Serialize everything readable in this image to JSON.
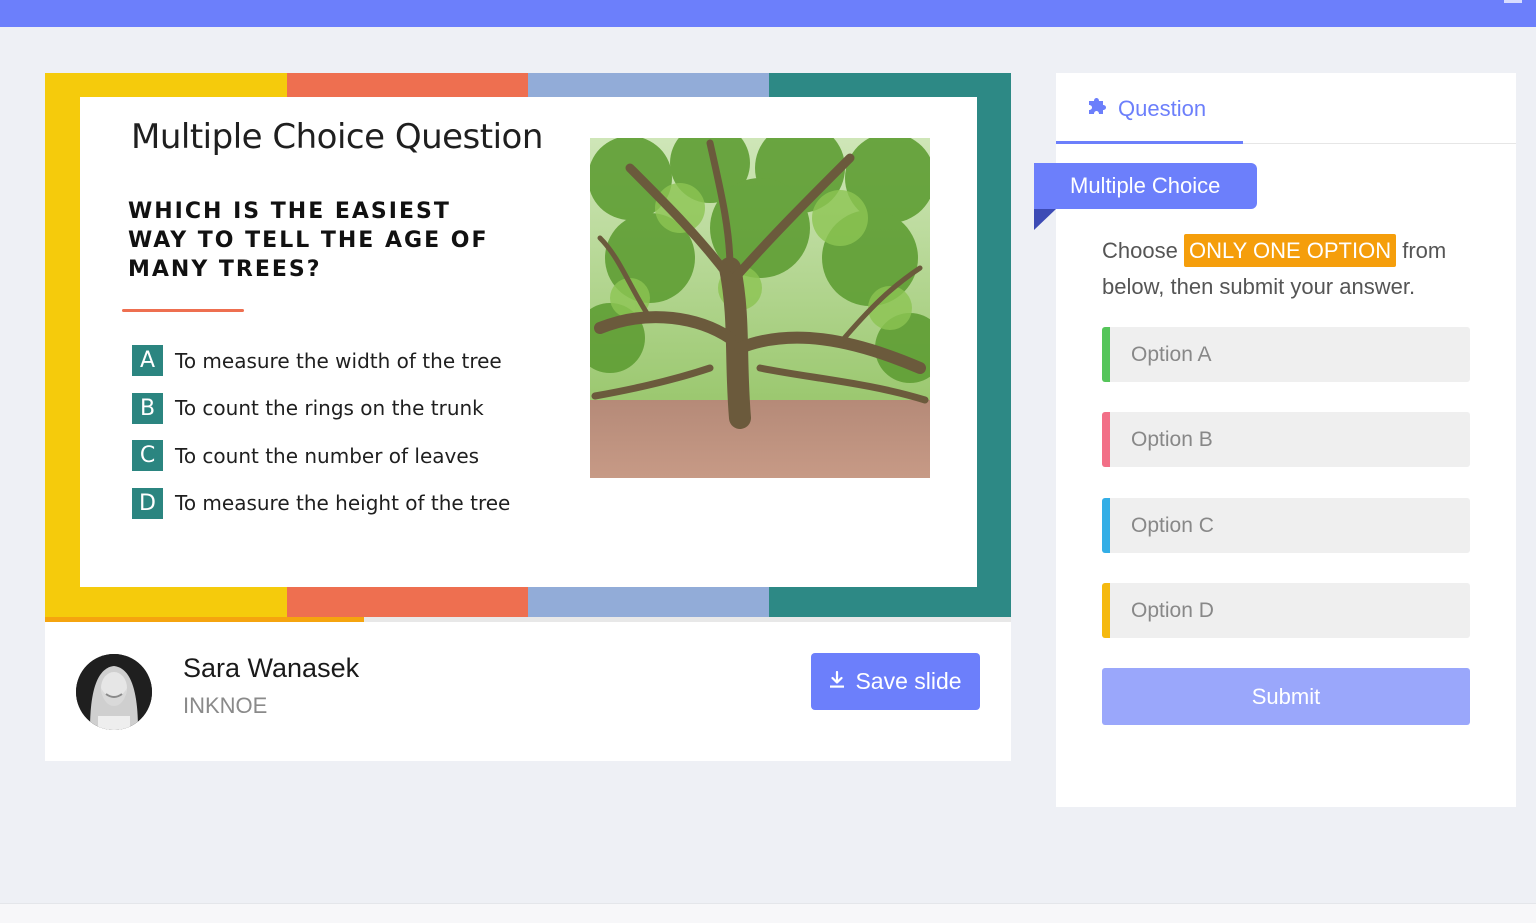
{
  "colors": {
    "accent": "#6c7ffb",
    "band_yellow": "#f5cb0c",
    "band_coral": "#ee6f50",
    "band_blue": "#92acd8",
    "band_teal": "#2d8985",
    "option_a": "#55c55a",
    "option_b": "#f26f87",
    "option_c": "#33aee6",
    "option_d": "#f5b90f",
    "highlight": "#f59e0b"
  },
  "slide": {
    "title": "Multiple Choice Question",
    "question": "WHICH IS THE EASIEST WAY TO TELL THE AGE OF MANY TREES?",
    "answers": [
      {
        "letter": "A",
        "text": "To measure the width of the tree"
      },
      {
        "letter": "B",
        "text": "To count the rings on the trunk"
      },
      {
        "letter": "C",
        "text": "To count the number of leaves"
      },
      {
        "letter": "D",
        "text": "To measure the height of the tree"
      }
    ],
    "image_icon": "tree-photo",
    "progress_fraction": 0.33
  },
  "author": {
    "name": "Sara Wanasek",
    "org": "INKNOE",
    "avatar_icon": "avatar-photo"
  },
  "toolbar": {
    "save_label": "Save slide",
    "save_icon": "download-icon"
  },
  "panel": {
    "tab_label": "Question",
    "tab_icon": "puzzle-icon",
    "type_label": "Multiple Choice",
    "instructions_pre": "Choose",
    "instructions_highlight": "ONLY ONE OPTION",
    "instructions_post": "from below, then submit your answer.",
    "options": [
      {
        "label": "Option A"
      },
      {
        "label": "Option B"
      },
      {
        "label": "Option C"
      },
      {
        "label": "Option D"
      }
    ],
    "submit_label": "Submit"
  }
}
